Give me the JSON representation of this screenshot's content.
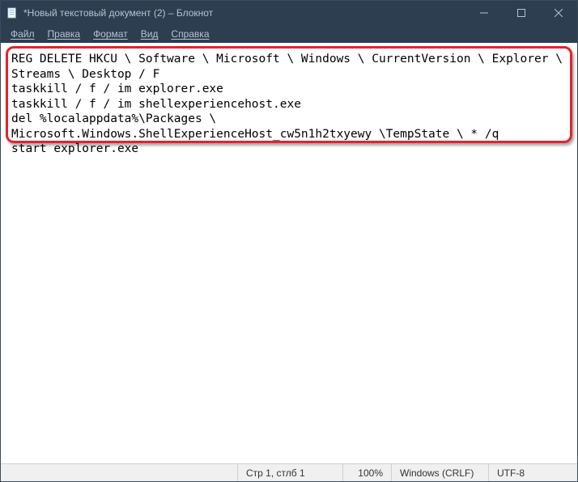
{
  "titlebar": {
    "title": "*Новый текстовый документ (2) – Блокнот"
  },
  "menu": {
    "file": "Файл",
    "edit": "Правка",
    "format": "Формат",
    "view": "Вид",
    "help": "Справка"
  },
  "editor": {
    "content": "REG DELETE HKCU \\ Software \\ Microsoft \\ Windows \\ CurrentVersion \\ Explorer \\ Streams \\ Desktop / F\ntaskkill / f / im explorer.exe\ntaskkill / f / im shellexperiencehost.exe\ndel %localappdata%\\Packages \\ Microsoft.Windows.ShellExperienceHost_cw5n1h2txyewy \\TempState \\ * /q\nstart explorer.exe"
  },
  "statusbar": {
    "position": "Стр 1, стлб 1",
    "zoom": "100%",
    "line_ending": "Windows (CRLF)",
    "encoding": "UTF-8"
  },
  "colors": {
    "titlebar_bg": "#2c3e50",
    "highlight_border": "#e3242b"
  }
}
